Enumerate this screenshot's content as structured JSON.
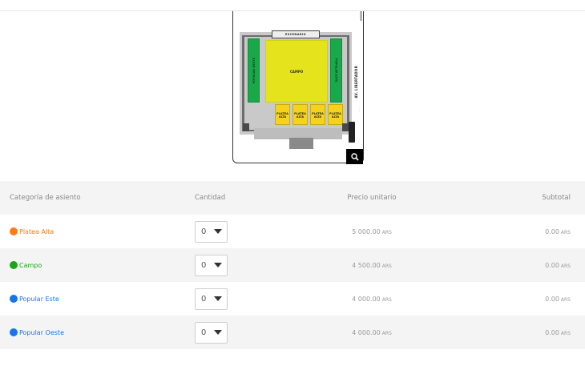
{
  "map": {
    "stage_label": "ESCENARIO",
    "field_label": "CAMPO",
    "popular_west_label": "POPULAR OESTE",
    "popular_east_label": "POPULAR ESTE",
    "street_label": "AV. LIBERTADOR",
    "platea_labels": [
      "PLATEA ALTA",
      "PLATEA ALTA",
      "PLATEA ALTA",
      "PLATEA ALTA"
    ],
    "zoom_icon": "search-icon"
  },
  "table": {
    "headers": {
      "category": "Categoría de asiento",
      "quantity": "Cantidad",
      "unit_price": "Precio unitario",
      "subtotal": "Subtotal"
    },
    "rows": [
      {
        "category": "Platea Alta",
        "color": "#ff7a1a",
        "quantity": "0",
        "price": "5 000.00",
        "price_currency": "ARS",
        "subtotal": "0.00",
        "subtotal_currency": "ARS"
      },
      {
        "category": "Campo",
        "color": "#1aa61a",
        "quantity": "0",
        "price": "4 500.00",
        "price_currency": "ARS",
        "subtotal": "0.00",
        "subtotal_currency": "ARS"
      },
      {
        "category": "Popular Este",
        "color": "#1a73e8",
        "quantity": "0",
        "price": "4 000.00",
        "price_currency": "ARS",
        "subtotal": "0.00",
        "subtotal_currency": "ARS"
      },
      {
        "category": "Popular Oeste",
        "color": "#1a73e8",
        "quantity": "0",
        "price": "4 000.00",
        "price_currency": "ARS",
        "subtotal": "0.00",
        "subtotal_currency": "ARS"
      }
    ]
  }
}
